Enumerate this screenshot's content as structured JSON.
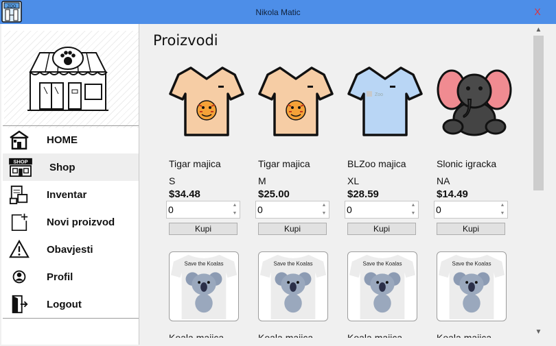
{
  "window": {
    "title": "Nikola Matic",
    "close_label": "X"
  },
  "nav": {
    "items": [
      {
        "label": "HOME",
        "icon": "home-icon"
      },
      {
        "label": "Shop",
        "icon": "shop-icon"
      },
      {
        "label": "Inventar",
        "icon": "inventory-icon"
      },
      {
        "label": "Novi proizvod",
        "icon": "add-product-icon"
      },
      {
        "label": "Obavjesti",
        "icon": "warning-icon"
      },
      {
        "label": "Profil",
        "icon": "user-icon"
      },
      {
        "label": "Logout",
        "icon": "logout-icon"
      }
    ],
    "active": "Shop"
  },
  "logo": {
    "sign_text": "SHOP"
  },
  "shop": {
    "title": "Proizvodi",
    "buy_label": "Kupi",
    "products": [
      {
        "name": "Tigar majica",
        "size": "S",
        "price": "$34.48",
        "qty": "0",
        "image": "tiger-shirt"
      },
      {
        "name": "Tigar majica",
        "size": "M",
        "price": "$25.00",
        "qty": "0",
        "image": "tiger-shirt"
      },
      {
        "name": "BLZoo majica",
        "size": "XL",
        "price": "$28.59",
        "qty": "0",
        "image": "zoo-shirt"
      },
      {
        "name": "Slonic igracka",
        "size": "NA",
        "price": "$14.49",
        "qty": "0",
        "image": "elephant-toy"
      },
      {
        "name": "Koala majica",
        "image": "koala-shirt",
        "shirt_text": "Save the Koalas"
      },
      {
        "name": "Koala majica",
        "image": "koala-shirt",
        "shirt_text": "Save the Koalas"
      },
      {
        "name": "Koala majica",
        "image": "koala-shirt",
        "shirt_text": "Save the Koalas"
      },
      {
        "name": "Koala majica",
        "image": "koala-shirt",
        "shirt_text": "Save the Koalas"
      }
    ]
  },
  "colors": {
    "titlebar": "#4d8ee8",
    "shirt_tan": "#f6cda5",
    "shirt_blue": "#b9d6f5",
    "elephant_ear": "#f08b91"
  }
}
